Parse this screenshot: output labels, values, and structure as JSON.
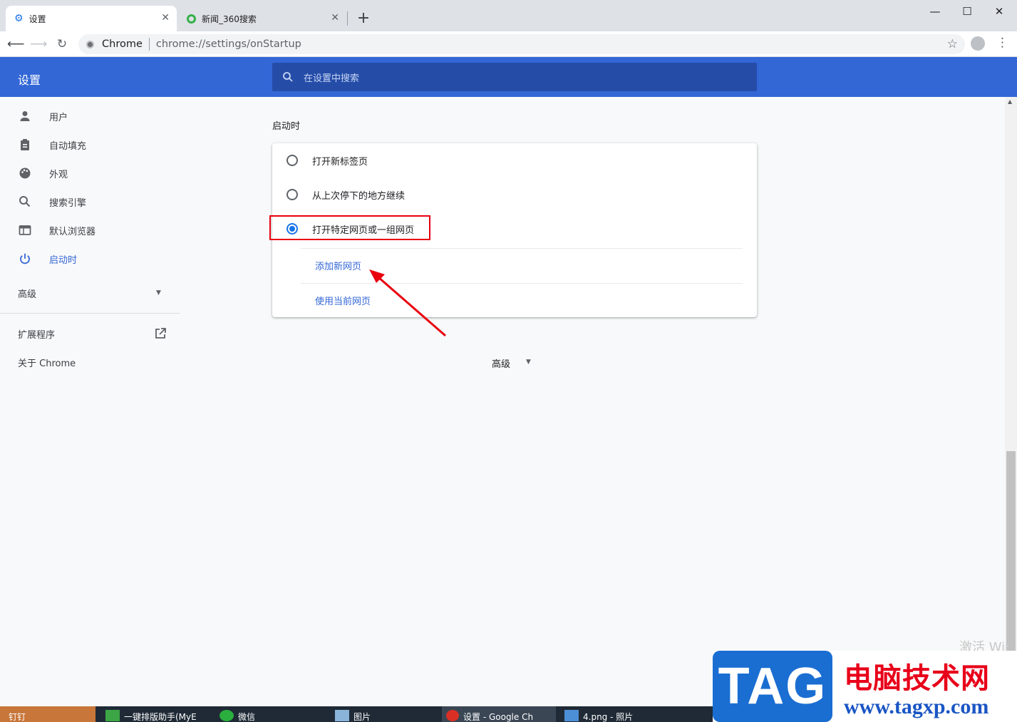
{
  "browser": {
    "tabs": [
      {
        "title": "设置",
        "active": true
      },
      {
        "title": "新闻_360搜索",
        "active": false
      }
    ],
    "new_tab_symbol": "+",
    "omnibox": {
      "scheme_label": "Chrome",
      "url": "chrome://settings/onStartup"
    }
  },
  "settings": {
    "header_title": "设置",
    "search_placeholder": "在设置中搜索",
    "sidebar": {
      "items": [
        {
          "label": "用户",
          "icon": "person-icon"
        },
        {
          "label": "自动填充",
          "icon": "clipboard-icon"
        },
        {
          "label": "外观",
          "icon": "palette-icon"
        },
        {
          "label": "搜索引擎",
          "icon": "search-icon"
        },
        {
          "label": "默认浏览器",
          "icon": "browser-window-icon"
        },
        {
          "label": "启动时",
          "icon": "power-icon",
          "active": true
        }
      ],
      "advanced": "高级",
      "extensions": "扩展程序",
      "about": "关于 Chrome"
    },
    "startup": {
      "section_title": "启动时",
      "options": [
        {
          "label": "打开新标签页",
          "selected": false
        },
        {
          "label": "从上次停下的地方继续",
          "selected": false
        },
        {
          "label": "打开特定网页或一组网页",
          "selected": true
        }
      ],
      "links": [
        "添加新网页",
        "使用当前网页"
      ]
    },
    "advanced_footer": "高级"
  },
  "colors": {
    "header": "#3367d6",
    "accent": "#1a73e8",
    "annotation": "#e8000f"
  },
  "taskbar": {
    "items": [
      "钉钉",
      "一键排版助手(MyE",
      "微信",
      "图片",
      "设置 - Google Ch",
      "4.png - 照片"
    ]
  },
  "watermark": {
    "activate_text": "激活 Wir",
    "logo_tag": "TAG",
    "logo_cn": "电脑技术网",
    "logo_url": "www.tagxp.com"
  }
}
